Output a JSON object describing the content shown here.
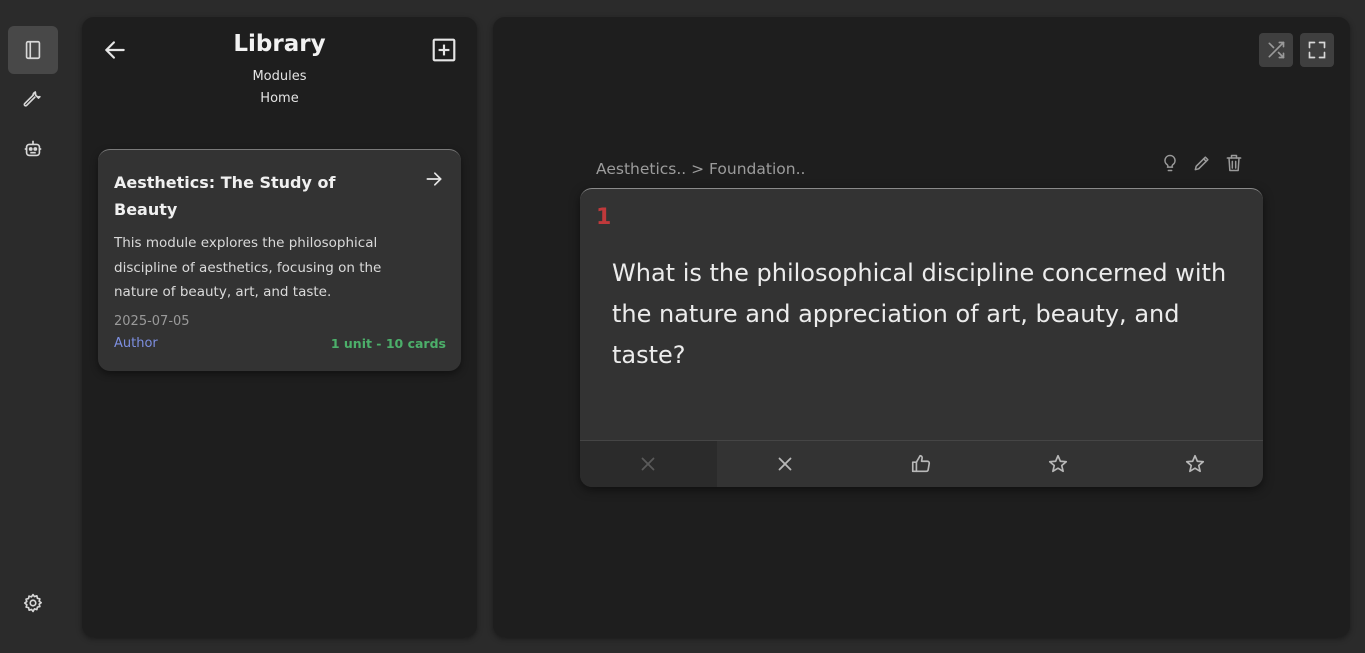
{
  "rail": {
    "items": [
      {
        "icon": "book-icon",
        "active": true
      },
      {
        "icon": "wrench-icon",
        "active": false
      },
      {
        "icon": "robot-icon",
        "active": false
      }
    ],
    "bottom_icon": "gear-icon"
  },
  "library": {
    "title": "Library",
    "nav_modules": "Modules",
    "nav_home": "Home",
    "module": {
      "title": "Aesthetics: The Study of Beauty",
      "description": "This module explores the philosophical discipline of aesthetics, focusing on the nature of beauty, art, and taste.",
      "date": "2025-07-05",
      "author": "Author",
      "count": "1 unit - 10 cards"
    }
  },
  "main": {
    "breadcrumb": "Aesthetics.. > Foundation..",
    "card": {
      "number": "1",
      "question": "What is the philosophical discipline concerned with the nature and appreciation of art, beauty, and taste?"
    },
    "rating_icons": [
      "x-icon",
      "x-icon",
      "thumbs-up-icon",
      "star-icon",
      "star-icon"
    ]
  },
  "colors": {
    "accent_red": "#c0393b",
    "author_blue": "#7d8fe0",
    "count_green": "#4caf6a"
  }
}
